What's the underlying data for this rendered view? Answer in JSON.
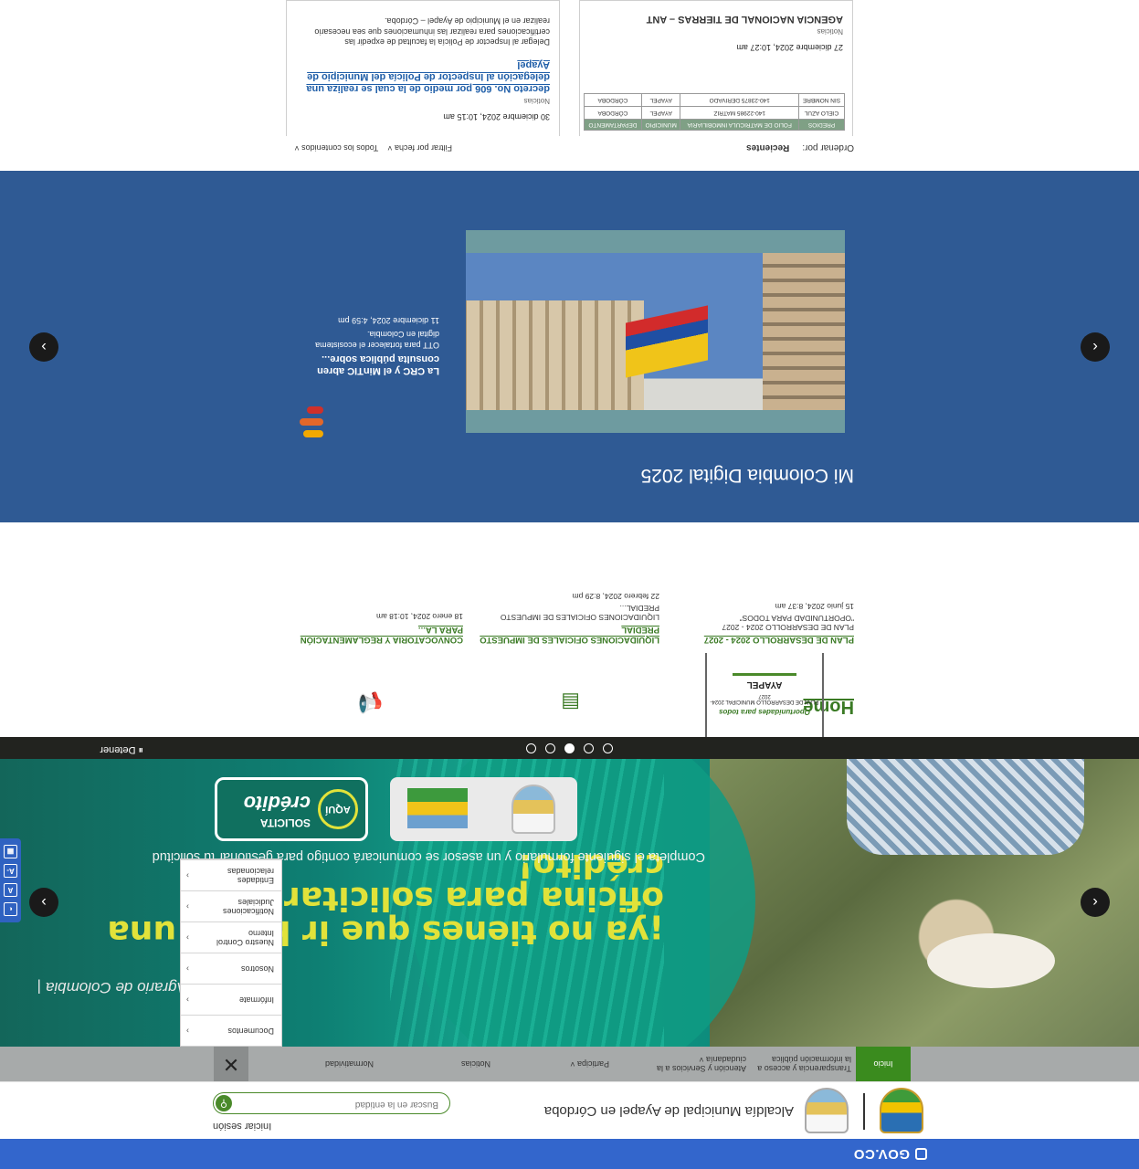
{
  "gov_bar": {
    "logo": "GOV.CO"
  },
  "header": {
    "site_title": "Alcaldía Municipal de Ayapel en Córdoba",
    "login": "Iniciar sesión",
    "search_placeholder": "Buscar en la entidad",
    "search_icon": "search-icon"
  },
  "nav": {
    "items": [
      {
        "label": "Inicio"
      },
      {
        "label": "Transparencia y acceso a la información pública"
      },
      {
        "label": "Atención y Servicios a la ciudadanía ˅"
      },
      {
        "label": "Participa ˅"
      },
      {
        "label": "Noticias"
      },
      {
        "label": "Normatividad"
      }
    ],
    "close": "✕"
  },
  "dropdown": {
    "items": [
      {
        "label": "Documentos"
      },
      {
        "label": "Infórmate"
      },
      {
        "label": "Nosotros"
      },
      {
        "label": "Nuestro Control Interno"
      },
      {
        "label": "Notificaciones Judiciales"
      },
      {
        "label": "Entidades relacionadas"
      }
    ]
  },
  "hero": {
    "headline": "¡ya no tienes que ir hasta una oficina para solicitar tu crédito!",
    "subtext": "Completa el siguiente formulario y un asesor se comunicará contigo para gestionar tu solicitud",
    "tagline": "co Agrario de Colombia |",
    "credit_line1": "SOLICITA",
    "credit_line2": "crédito",
    "credit_aqui": "AQUÍ",
    "stop_label": "⏸ Detener",
    "slides": 5,
    "active_slide": 3
  },
  "accessibility": {
    "buttons": [
      "◐",
      "A",
      "A-",
      "▦"
    ]
  },
  "home": {
    "title": "Home",
    "doc_thumb": {
      "org": "AYAPEL",
      "subtitle": "PLAN DE DESARROLLO MUNICIPAL 2024-2027",
      "slogan": "Oportunidades para todos"
    },
    "news": [
      {
        "title": "PLAN DE DESARROLLO 2024 - 2027",
        "excerpt": "PLAN DE DESARROLLO 2024 - 2027 \"OPORTUNIDAD PARA TODOS\"",
        "date": "15 junio 2024, 8:37 am"
      },
      {
        "title": "LIQUIDACIONES OFICIALES DE IMPUESTO PREDIAL",
        "excerpt": "LIQUIDACIONES OFICIALES DE IMPUESTO PREDIAL...",
        "date": "22 febrero 2024, 8:29 pm"
      },
      {
        "title": "CONVOCATORIA Y REGLAMENTACIÓN PARA LA...",
        "excerpt": "",
        "date": "18 enero 2024, 10:18 am"
      }
    ]
  },
  "mcd": {
    "title": "Mi Colombia Digital 2025",
    "news_title": "La CRC y el MinTIC abren consulta pública sobre...",
    "news_excerpt": "OTT para fortalecer el ecosistema digital en Colombia.",
    "news_date": "11 diciembre 2024, 4:59 pm"
  },
  "notices": {
    "order_label": "Ordenar por:",
    "order_value": "Recientes",
    "filter_date": "Filtrar por fecha ˅",
    "filter_all": "Todos los contenidos ˅",
    "left": {
      "table_headers": [
        "PREDIOS",
        "FOLIO DE MATRICULA INMOBILIARIA",
        "MUNICIPIO",
        "DEPARTAMENTO"
      ],
      "table_rows": [
        [
          "CIELO AZUL",
          "140-22985 MATRIZ",
          "AYAPEL",
          "CÓRDOBA"
        ],
        [
          "SIN NOMBRE",
          "140-23875 DERIVADO",
          "AYAPEL",
          "CÓRDOBA"
        ]
      ],
      "date": "27 diciembre 2024, 10:27 am",
      "category": "Noticias",
      "title": "AGENCIA NACIONAL DE TIERRAS – ANT"
    },
    "right": {
      "date": "30 diciembre 2024, 10:15 am",
      "category": "Noticias",
      "title": "decreto No. 606 por medio de la cual se realiza una delegación al Inspector de Policía del Municipio de Ayapel",
      "excerpt": "Delegar al Inspector de Policía la facultad de expedir las certificaciones para realizar las inhumaciones que sea necesario realizar en el Municipio de Ayapel – Córdoba."
    }
  }
}
